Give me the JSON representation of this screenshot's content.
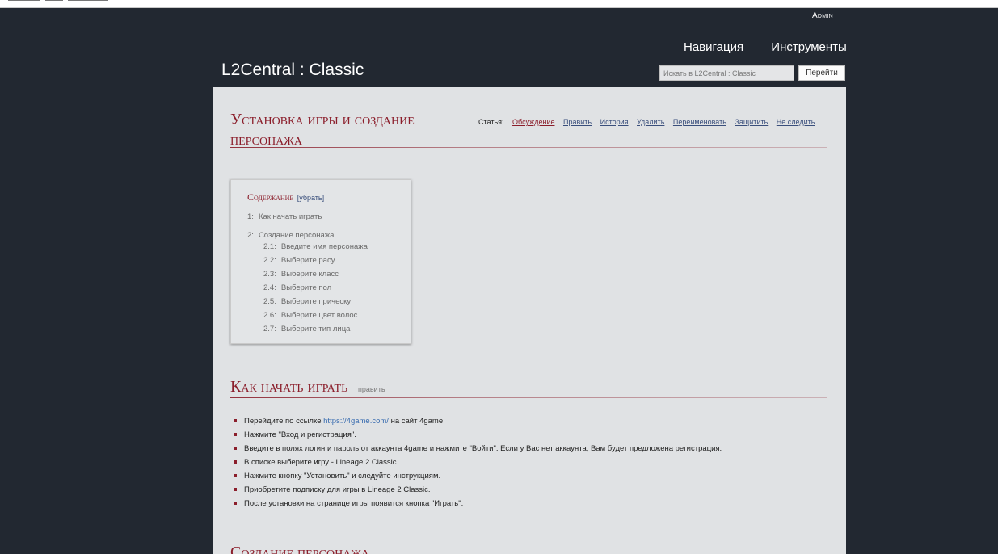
{
  "header": {
    "user": "Admin",
    "nav": [
      "Навигация",
      "Инструменты"
    ],
    "site_title": "L2Central : Classic",
    "search": {
      "placeholder": "Искать в L2Central : Classic",
      "button": "Перейти"
    }
  },
  "page": {
    "title": "Установка игры и создание персонажа",
    "tabs": [
      "Статья:",
      "Обсуждение",
      "Править",
      "История",
      "Удалить",
      "Переименовать",
      "Защитить",
      "Не следить"
    ]
  },
  "toc": {
    "title": "Содержание",
    "toggle": "[убрать]",
    "items": [
      {
        "num": "1:",
        "label": "Как начать играть"
      },
      {
        "num": "2:",
        "label": "Создание персонажа"
      }
    ],
    "sub_items": [
      {
        "num": "2.1:",
        "label": "Введите имя персонажа"
      },
      {
        "num": "2.2:",
        "label": "Выберите расу"
      },
      {
        "num": "2.3:",
        "label": "Выберите класс"
      },
      {
        "num": "2.4:",
        "label": "Выберите пол"
      },
      {
        "num": "2.5:",
        "label": "Выберите прическу"
      },
      {
        "num": "2.6:",
        "label": "Выберите цвет волос"
      },
      {
        "num": "2.7:",
        "label": "Выберите тип лица"
      }
    ]
  },
  "section1": {
    "heading": "Как начать играть",
    "edit": "править",
    "step1": {
      "before": "Перейдите по ссылке ",
      "link": "https://4game.com/",
      "after": " на сайт 4game."
    },
    "steps": [
      "Нажмите \"Вход и регистрация\".",
      "Введите в полях логин и пароль от аккаунта 4game и нажмите \"Войти\". Если у Вас нет аккаунта, Вам будет предложена регистрация.",
      "В списке выберите игру - Lineage 2 Classic.",
      "Нажмите кнопку \"Установить\" и следуйте инструкциям.",
      "Приобретите подписку для игры в Lineage 2 Classic.",
      "После установки на странице игры появится кнопка \"Играть\"."
    ]
  },
  "section2": {
    "heading": "Создание персонажа"
  }
}
